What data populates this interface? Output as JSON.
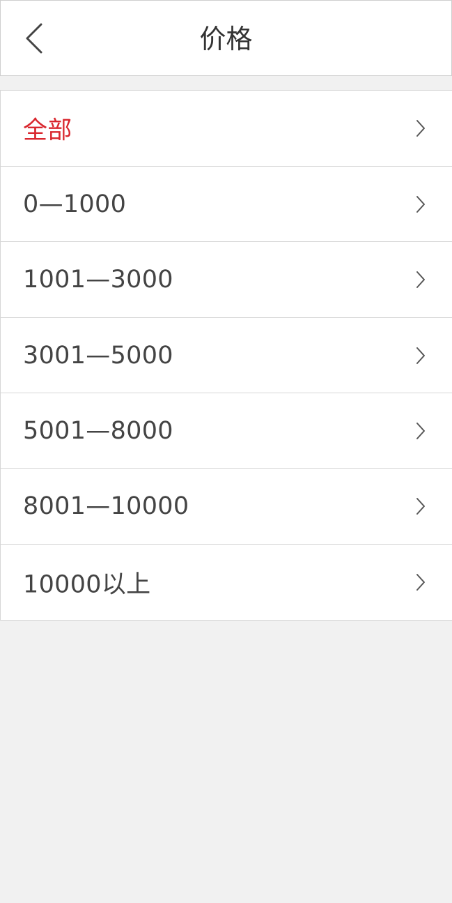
{
  "header": {
    "title": "价格",
    "back_icon": "chevron-left-icon"
  },
  "filter_list": {
    "items": [
      {
        "label": "全部",
        "active": true
      },
      {
        "label": "0—1000",
        "active": false
      },
      {
        "label": "1001—3000",
        "active": false
      },
      {
        "label": "3001—5000",
        "active": false
      },
      {
        "label": "5001—8000",
        "active": false
      },
      {
        "label": "8001—10000",
        "active": false
      },
      {
        "label": "10000以上",
        "active": false
      }
    ],
    "item_icon": "chevron-right-icon"
  },
  "colors": {
    "active_text": "#d9272e",
    "text": "#444444",
    "background": "#f1f1f1",
    "divider": "#d6d6d6"
  }
}
